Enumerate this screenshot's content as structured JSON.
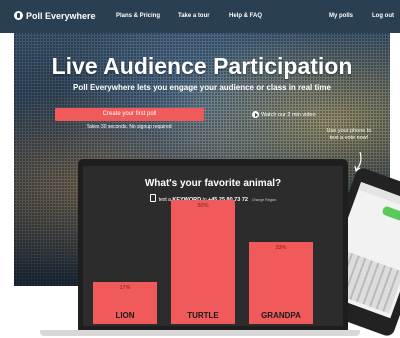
{
  "nav": {
    "brand": "Poll Everywhere",
    "links": [
      "Plans & Pricing",
      "Take a tour",
      "Help & FAQ"
    ],
    "right_links": [
      "My polls",
      "Log out"
    ]
  },
  "hero": {
    "title": "Live Audience Participation",
    "subtitle": "Poll Everywhere lets you engage your audience or class in real time",
    "cta_label": "Create your first poll",
    "cta_note": "Takes 30 seconds. No signup required",
    "video_link": "Watch our 2 min video",
    "phone_note": "Use your phone to text a vote now!"
  },
  "poll": {
    "question": "What's your favorite animal?",
    "text_prefix": "text a",
    "keyword": "KEYWORD",
    "to_word": "to",
    "number": "+45 25 80 73 72",
    "change_region": "Change Region",
    "footnote": "Message and data rates may apply"
  },
  "chart_data": {
    "type": "bar",
    "title": "What's your favorite animal?",
    "categories": [
      "LION",
      "TURTLE",
      "GRANDPA"
    ],
    "values": [
      17,
      50,
      33
    ],
    "value_suffix": "%",
    "ylim": [
      0,
      50
    ],
    "color": "#f05a5a"
  },
  "colors": {
    "nav_bg": "#2a3f52",
    "cta": "#f05a5a",
    "bar": "#f05a5a"
  }
}
